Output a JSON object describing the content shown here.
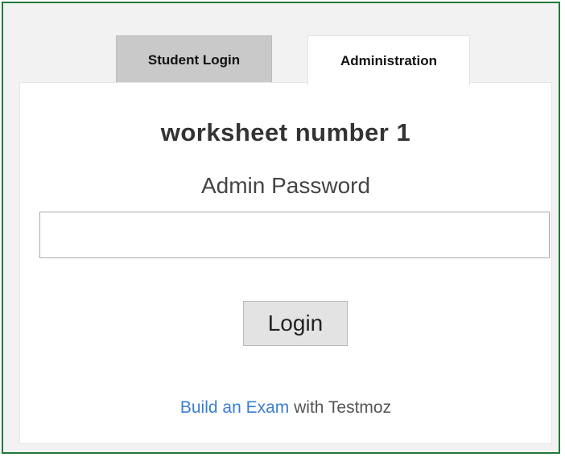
{
  "tabs": {
    "student_label": "Student Login",
    "admin_label": "Administration"
  },
  "main": {
    "title": "worksheet number 1",
    "password_label": "Admin Password",
    "password_value": "",
    "login_label": "Login"
  },
  "footer": {
    "link_text": "Build an Exam",
    "suffix_text": " with Testmoz"
  },
  "colors": {
    "link": "#3a7fd0",
    "frame_border": "#1f7a3a",
    "inactive_tab": "#c9c9c9"
  }
}
